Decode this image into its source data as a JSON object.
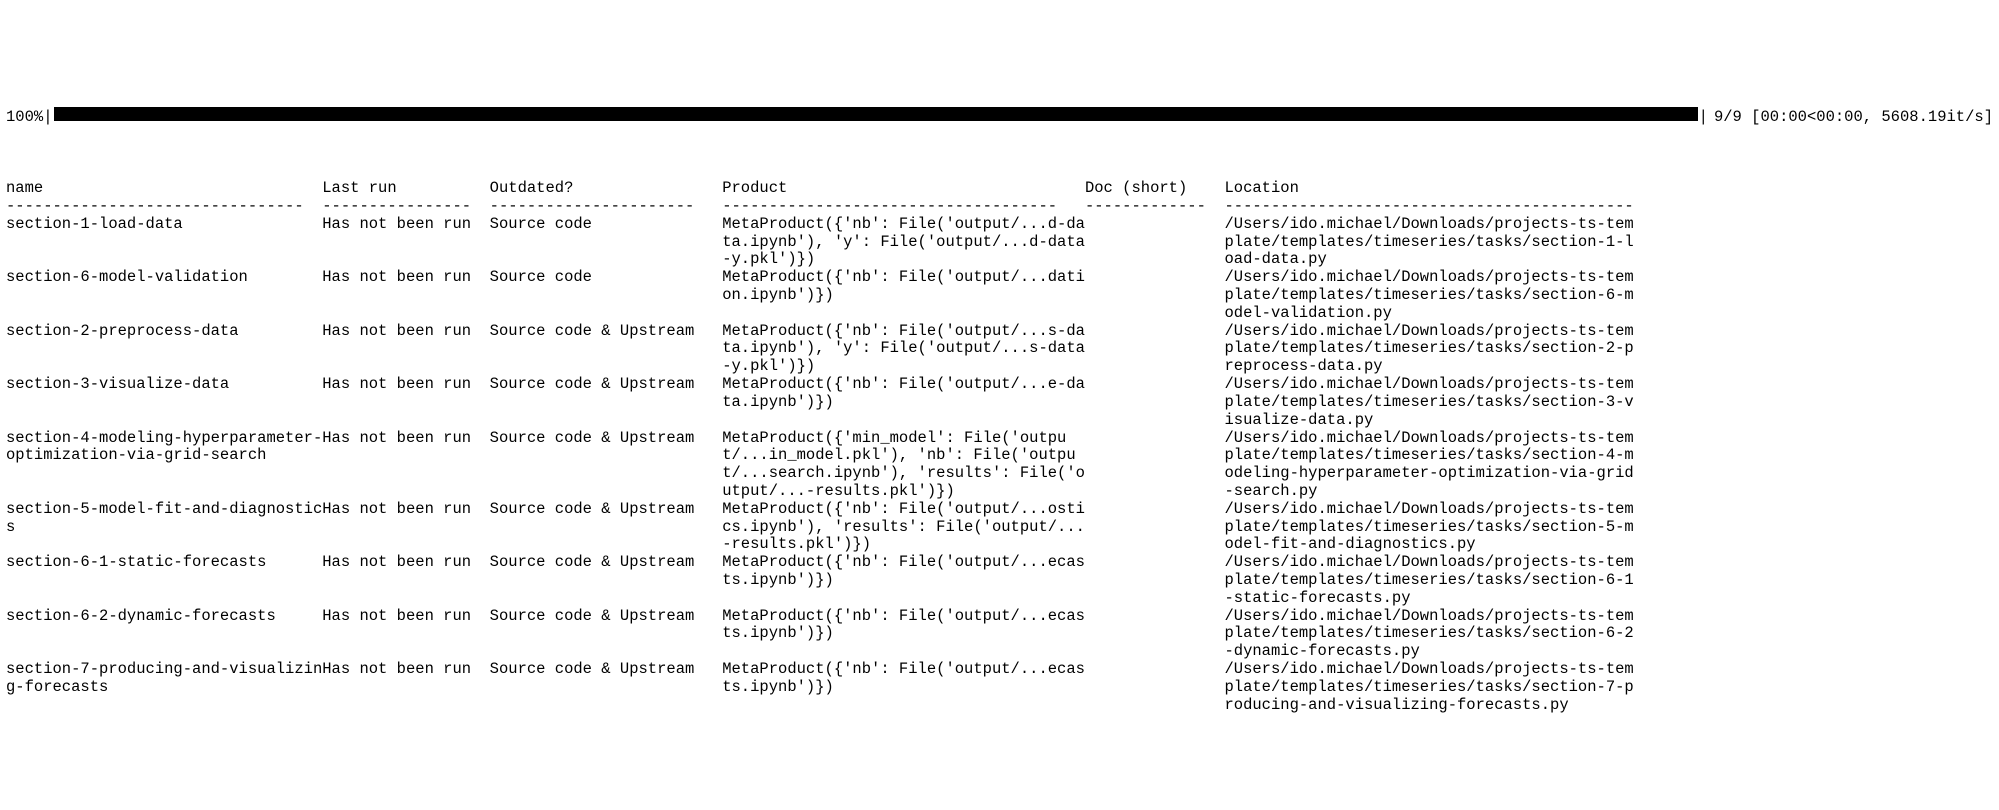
{
  "progress": {
    "percent_label": "100%",
    "stats": "9/9 [00:00<00:00, 5608.19it/s]"
  },
  "columns": {
    "name": {
      "header": "name",
      "dashes": "--------------------------------  "
    },
    "last": {
      "header": "Last run",
      "dashes": "----------------  "
    },
    "out": {
      "header": "Outdated?",
      "dashes": "----------------------   "
    },
    "prod": {
      "header": "Product",
      "dashes": "------------------------------------   "
    },
    "doc": {
      "header": "Doc (short)",
      "dashes": "-------------  "
    },
    "loc": {
      "header": "Location",
      "dashes": "--------------------------------------------"
    }
  },
  "rows": [
    {
      "name": "section-1-load-data",
      "last": "Has not been run",
      "out": "Source code",
      "prod": "MetaProduct({'nb': File('output/...d-data.ipynb'), 'y': File('output/...d-data-y.pkl')})",
      "doc": "",
      "loc": "/Users/ido.michael/Downloads/projects-ts-template/templates/timeseries/tasks/section-1-load-data.py"
    },
    {
      "name": "section-6-model-validation",
      "last": "Has not been run",
      "out": "Source code",
      "prod": "MetaProduct({'nb': File('output/...dation.ipynb')})",
      "doc": "",
      "loc": "/Users/ido.michael/Downloads/projects-ts-template/templates/timeseries/tasks/section-6-model-validation.py"
    },
    {
      "name": "section-2-preprocess-data",
      "last": "Has not been run",
      "out": "Source code & Upstream",
      "prod": "MetaProduct({'nb': File('output/...s-data.ipynb'), 'y': File('output/...s-data-y.pkl')})",
      "doc": "",
      "loc": "/Users/ido.michael/Downloads/projects-ts-template/templates/timeseries/tasks/section-2-preprocess-data.py"
    },
    {
      "name": "section-3-visualize-data",
      "last": "Has not been run",
      "out": "Source code & Upstream",
      "prod": "MetaProduct({'nb': File('output/...e-data.ipynb')})",
      "doc": "",
      "loc": "/Users/ido.michael/Downloads/projects-ts-template/templates/timeseries/tasks/section-3-visualize-data.py"
    },
    {
      "name": "section-4-modeling-hyperparameter-optimization-via-grid-search",
      "last": "Has not been run",
      "out": "Source code & Upstream",
      "prod": "MetaProduct({'min_model': File('output/...in_model.pkl'), 'nb': File('output/...search.ipynb'), 'results': File('output/...-results.pkl')})",
      "doc": "",
      "loc": "/Users/ido.michael/Downloads/projects-ts-template/templates/timeseries/tasks/section-4-modeling-hyperparameter-optimization-via-grid-search.py"
    },
    {
      "name": "section-5-model-fit-and-diagnostics",
      "last": "Has not been run",
      "out": "Source code & Upstream",
      "prod": "MetaProduct({'nb': File('output/...ostics.ipynb'), 'results': File('output/...-results.pkl')})",
      "doc": "",
      "loc": "/Users/ido.michael/Downloads/projects-ts-template/templates/timeseries/tasks/section-5-model-fit-and-diagnostics.py"
    },
    {
      "name": "section-6-1-static-forecasts",
      "last": "Has not been run",
      "out": "Source code & Upstream",
      "prod": "MetaProduct({'nb': File('output/...ecasts.ipynb')})",
      "doc": "",
      "loc": "/Users/ido.michael/Downloads/projects-ts-template/templates/timeseries/tasks/section-6-1-static-forecasts.py"
    },
    {
      "name": "section-6-2-dynamic-forecasts",
      "last": "Has not been run",
      "out": "Source code & Upstream",
      "prod": "MetaProduct({'nb': File('output/...ecasts.ipynb')})",
      "doc": "",
      "loc": "/Users/ido.michael/Downloads/projects-ts-template/templates/timeseries/tasks/section-6-2-dynamic-forecasts.py"
    },
    {
      "name": "section-7-producing-and-visualizing-forecasts",
      "last": "Has not been run",
      "out": "Source code & Upstream",
      "prod": "MetaProduct({'nb': File('output/...ecasts.ipynb')})",
      "doc": "",
      "loc": "/Users/ido.michael/Downloads/projects-ts-template/templates/timeseries/tasks/section-7-producing-and-visualizing-forecasts.py"
    }
  ]
}
